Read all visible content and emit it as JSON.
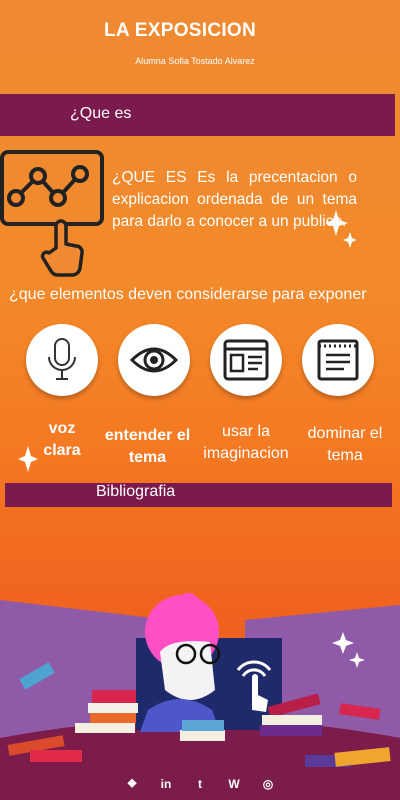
{
  "header": {
    "title": "LA EXPOSICION",
    "author": "Alumna Sofia Tostado Alvarez"
  },
  "section1": {
    "label": "¿Que es"
  },
  "definition": "¿QUE ES  Es la precentacion o explicacion ordenada de un tema para darlo a conocer a un publico.",
  "question": "¿que elementos deven considerarse para exponer",
  "elements": [
    {
      "label": "voz clara",
      "icon": "microphone-icon"
    },
    {
      "label": "entender el tema",
      "icon": "eye-icon"
    },
    {
      "label": "usar la imaginacion",
      "icon": "browser-window-icon"
    },
    {
      "label": "dominar el tema",
      "icon": "notepad-icon"
    }
  ],
  "section2": {
    "label": "Bibliografia"
  },
  "footer": {
    "icons": [
      "dropbox-icon",
      "linkedin-icon",
      "tumblr-icon",
      "wordpress-icon",
      "instagram-icon"
    ],
    "glyphs": [
      "⯁",
      "in",
      "t",
      "W",
      "◎"
    ]
  },
  "colors": {
    "band": "#7a1a4d",
    "background_top": "#ef8a33",
    "background_bottom": "#e5541c",
    "purple": "#8f5aa8"
  }
}
